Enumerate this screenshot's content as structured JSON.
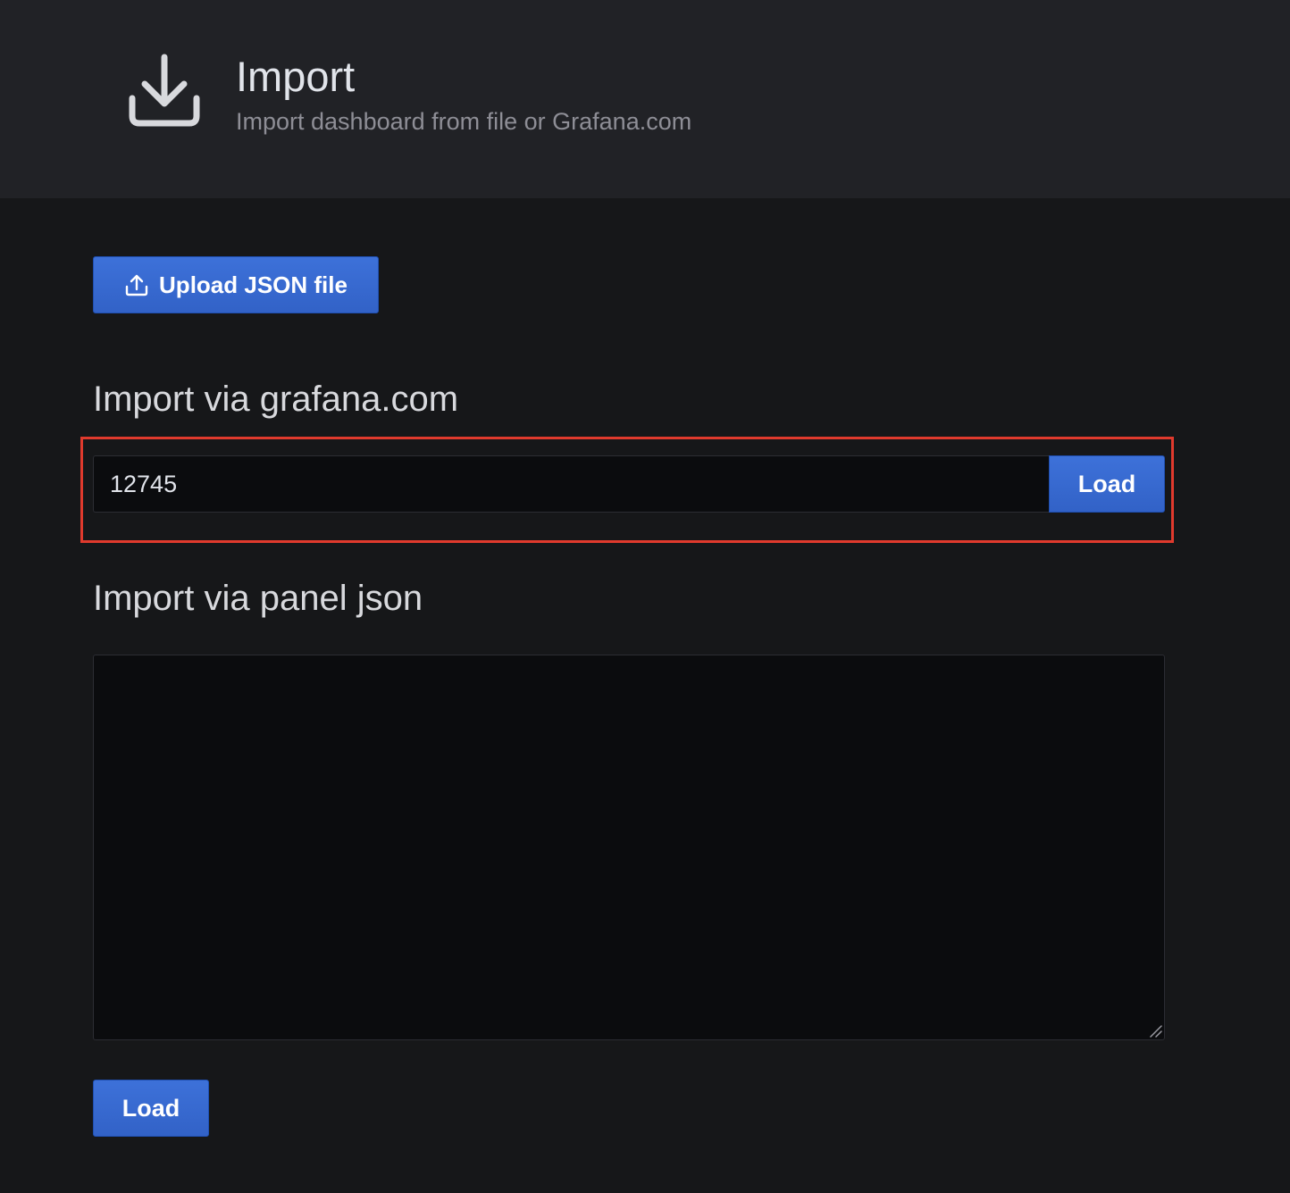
{
  "header": {
    "icon": "import-download-icon",
    "title": "Import",
    "subtitle": "Import dashboard from file or Grafana.com"
  },
  "upload": {
    "icon": "upload-icon",
    "label": "Upload JSON file"
  },
  "grafana_import": {
    "heading": "Import via grafana.com",
    "input_value": "12745",
    "load_label": "Load"
  },
  "panel_json_import": {
    "heading": "Import via panel json",
    "textarea_value": "",
    "load_label": "Load"
  },
  "colors": {
    "page_background": "#161719",
    "header_background": "#212226",
    "primary_button": "#3d71d9",
    "input_background": "#0b0c0e",
    "highlight_border": "#e03a2d"
  }
}
